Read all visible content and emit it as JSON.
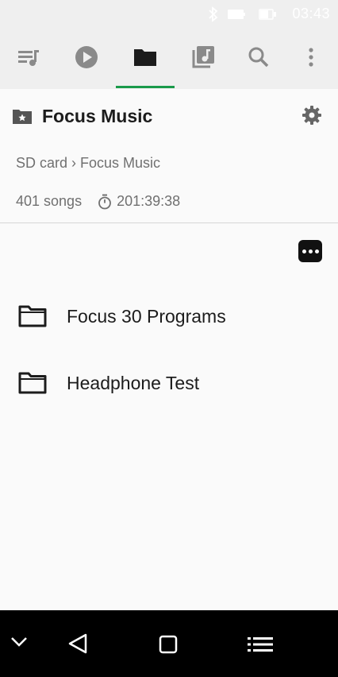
{
  "status_bar": {
    "time": "03:43",
    "icons": [
      "bluetooth-icon",
      "battery-icon",
      "battery-charging-icon"
    ]
  },
  "toolbar": {
    "tabs": [
      {
        "icon": "queue-music-icon",
        "label": "Queue"
      },
      {
        "icon": "play-circle-icon",
        "label": "Now Playing"
      },
      {
        "icon": "folder-icon",
        "label": "Folders",
        "selected": true
      },
      {
        "icon": "library-music-icon",
        "label": "Library"
      },
      {
        "icon": "search-icon",
        "label": "Search"
      },
      {
        "icon": "more-vert-icon",
        "label": "More"
      }
    ],
    "accent_color": "#1a9a4a"
  },
  "header": {
    "title": "Focus Music",
    "breadcrumb": "SD card › Focus Music",
    "song_count": "401 songs",
    "duration": "201:39:38"
  },
  "list": {
    "items": [
      {
        "label": "Focus 30 Programs",
        "icon": "folder-icon"
      },
      {
        "label": "Headphone Test",
        "icon": "folder-icon"
      }
    ]
  },
  "nav_bar": {
    "buttons": [
      "chevron-down-icon",
      "back-icon",
      "home-icon",
      "menu-icon"
    ]
  }
}
